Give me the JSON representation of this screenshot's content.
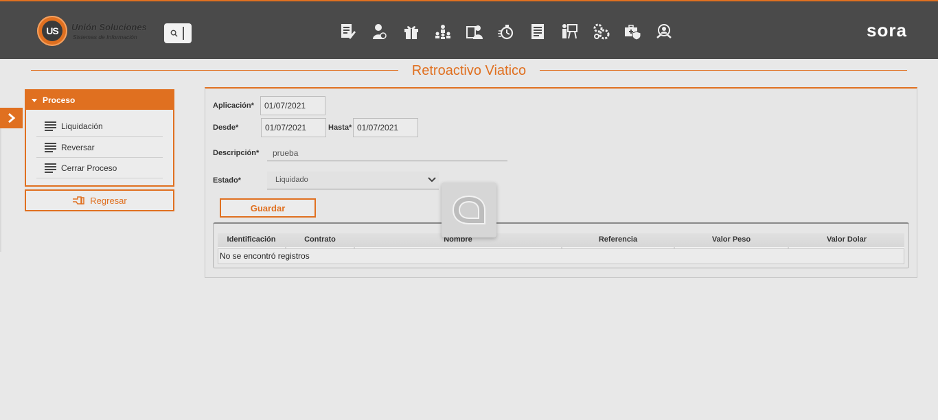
{
  "header": {
    "logo_mark": "US",
    "logo_title": "Unión Soluciones",
    "logo_subtitle": "Sistemas de Información",
    "brand": "sora",
    "accent_color": "#e07020",
    "bar_color": "#4a4a4a",
    "nav_icons": [
      "document-edit-icon",
      "user-money-icon",
      "gift-icon",
      "hierarchy-people-icon",
      "user-card-icon",
      "stopwatch-icon",
      "report-list-icon",
      "presentation-icon",
      "gears-icon",
      "medical-kit-shield-icon",
      "user-search-icon"
    ]
  },
  "page_title": "Retroactivo Viatico",
  "sidebar": {
    "section_title": "Proceso",
    "items": [
      {
        "label": "Liquidación"
      },
      {
        "label": "Reversar"
      },
      {
        "label": "Cerrar Proceso"
      }
    ],
    "back_label": "Regresar"
  },
  "form": {
    "aplicacion_label": "Aplicación*",
    "aplicacion_value": "01/07/2021",
    "desde_label": "Desde*",
    "desde_value": "01/07/2021",
    "hasta_label": "Hasta*",
    "hasta_value": "01/07/2021",
    "descripcion_label": "Descripción*",
    "descripcion_value": "prueba",
    "estado_label": "Estado*",
    "estado_value": "Liquidado",
    "save_label": "Guardar"
  },
  "table": {
    "columns": [
      "Identificación",
      "Contrato",
      "Nombre",
      "Referencia",
      "Valor Peso",
      "Valor Dolar"
    ],
    "empty_message": "No se encontró registros"
  }
}
